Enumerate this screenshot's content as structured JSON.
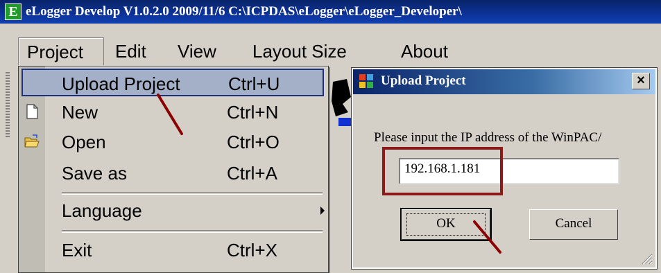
{
  "window": {
    "icon_letter": "E",
    "title": "eLogger Develop V1.0.2.0  2009/11/6  C:\\ICPDAS\\eLogger\\eLogger_Developer\\"
  },
  "menubar": {
    "items": [
      {
        "label": "Project"
      },
      {
        "label": "Edit"
      },
      {
        "label": "View"
      },
      {
        "label": "Layout Size"
      },
      {
        "label": "About"
      }
    ]
  },
  "project_menu": {
    "items": [
      {
        "label": "Upload Project",
        "shortcut": "Ctrl+U",
        "icon": null
      },
      {
        "label": "New",
        "shortcut": "Ctrl+N",
        "icon": "new-file-icon"
      },
      {
        "label": "Open",
        "shortcut": "Ctrl+O",
        "icon": "open-folder-icon"
      },
      {
        "label": "Save as",
        "shortcut": "Ctrl+A",
        "icon": null
      },
      {
        "label": "Language",
        "shortcut": "",
        "icon": "submenu-arrow-icon"
      },
      {
        "label": "Exit",
        "shortcut": "Ctrl+X",
        "icon": null
      }
    ]
  },
  "dialog": {
    "title": "Upload Project",
    "close_label": "×",
    "prompt": "Please input the IP address of the WinPAC/",
    "ip_value": "192.168.1.181",
    "ok_label": "OK",
    "cancel_label": "Cancel"
  },
  "colors": {
    "annotation_red": "#8b0000",
    "annotation_box": "#8b1a1a",
    "title_bar": "#0a246a",
    "menu_highlight": "#a4b0c8"
  }
}
